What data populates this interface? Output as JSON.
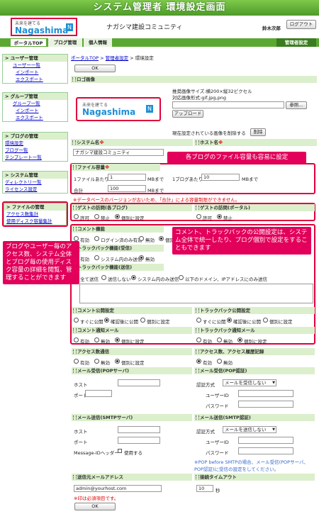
{
  "banner": "システム管理者 環境設定画面",
  "header": {
    "logo_small": "未来を建てる",
    "logo_big": "Nagashima",
    "logo_n": "N",
    "site_name": "ナガシマ建設コミュニティ",
    "user": "鈴木次郎",
    "logout": "ログアウト"
  },
  "tabs": {
    "portal": "ポータルTOP",
    "blog": "ブログ管理",
    "personal": "個人情報",
    "admin": "管理者設定"
  },
  "sidebar": {
    "user_mgmt": "ユーザー管理",
    "user_list": "ユーザー一覧",
    "user_import": "インポート",
    "user_export": "エクスポート",
    "group_mgmt": "グループ管理",
    "group_list": "グループ一覧",
    "group_import": "インポート",
    "group_export": "エクスポート",
    "blog_mgmt": "ブログの管理",
    "env": "環境設定",
    "blog_list": "ブログ一覧",
    "template_list": "テンプレート一覧",
    "sys_mgmt": "システム管理",
    "dir_list": "ディレクトリ一覧",
    "license": "ライセンス設定",
    "file_mgmt": "ファイルの管理",
    "access": "アクセス数集計",
    "disk": "使用ディスク容量集計"
  },
  "main": {
    "crumb_portal": "ポータルTOP",
    "crumb_admin": "管理者設定",
    "crumb_current": " > 環境設定",
    "ok": "OK",
    "logo_sec": "ロゴ画像",
    "logo_size": "推奨画像サイズ:横200×縦32ピクセル",
    "logo_format": "対応画像形式:gif,jpg,png",
    "browse": "参照...",
    "upload": "アップロード",
    "delete_note": "現在設定されている画像を削除する",
    "delete": "削除",
    "system_name_sec": "システム名",
    "system_name": "ナガシマ建設コミュニティ",
    "host_name_sec": "ホスト名",
    "file_sec": "ファイル容量",
    "per_file": "1ファイルあたり",
    "per_file_val": "1",
    "mb1": "MBまで",
    "per_blog": "1ブログあたり",
    "per_blog_val": "10",
    "mb2": "MBまで",
    "total": "合計",
    "total_val": "100",
    "mb3": "MBまで",
    "db_note": "※データベースのバージョンが古いため、「合計」による容量制限ができません。",
    "guest_blog_sec": "ゲストの訪問(各ブログ)",
    "guest_portal_sec": "ゲストの訪問(ポータル)",
    "allow": "許可",
    "forbid": "禁止",
    "individual": "個別に設定",
    "comment_sec": "コメント機能",
    "valid": "有効",
    "login_valid": "ログイン済のみ有効",
    "invalid": "無効",
    "indiv": "個別に設定",
    "tb_recv_sec": "トラックバック機能(受信)",
    "tb_recv_opts": "有効 システム内のみ受信 無効",
    "tb_send_sec": "トラックバック機能(送信)",
    "send_all": "全て送信",
    "send_none": "送信しない",
    "send_system": "システム内のみ送信",
    "send_domain": "以下のドメイン、IPアドレスにのみ送信",
    "comment_pub_sec": "コメント公開設定",
    "tb_pub_sec": "トラックバック公開設定",
    "pub_now": "すぐに公開",
    "pub_confirm": "確認後に公開",
    "pub_indiv": "個別に設定",
    "comment_mail_sec": "コメント通知メール",
    "tb_mail_sec": "トラックバック通知メール",
    "access_sec": "アクセス数通信",
    "access_log_sec": "アクセス数、アクセス履歴記録",
    "mail_pop_sec": "メール受信(POPサーバ)",
    "mail_pop_auth_sec": "メール受信(POP認証)",
    "host": "ホスト",
    "port": "ポート",
    "auth": "認証方式",
    "auth_val": "メールを受信しない",
    "user_id": "ユーザーID",
    "password": "パスワード",
    "smtp_sec": "メール送信(SMTPサーバ)",
    "smtp_auth_sec": "メール送信(SMTP認証)",
    "msgid": "Message-IDヘッダー",
    "use": "使用する",
    "auth_val2": "メールを送信しない",
    "smtp_note": "※POP before SMTPの場合、メール受信(POPサーバ、POP認証)に受信の設定をしてください。",
    "from_sec": "送信元メールアドレス",
    "from_val": "admin@yourhost.com",
    "req_note": "※印は必須項目です。",
    "timeout_sec": "接続タイムアウト",
    "timeout_val": "10",
    "sec_unit": "秒"
  },
  "callouts": {
    "c1": "各ブログのファイル容量も容易に設定",
    "c2": "コメント、トラックバックの公開設定は、システム全体で統一したり、ブログ個別で設定をすることもできます",
    "c3": "ブログやユーザー毎のアクセス数、システム全体とブログ毎の使用ディスク容量の詳細を閲覧、管理することができます"
  }
}
